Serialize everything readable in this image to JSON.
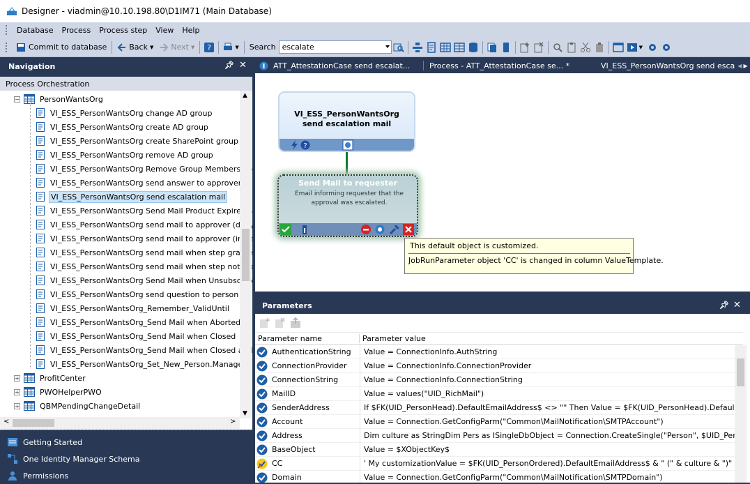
{
  "window": {
    "title": "Designer - viadmin@10.10.198.80\\D1IM71 (Main Database)"
  },
  "menu": [
    "Database",
    "Process",
    "Process step",
    "View",
    "Help"
  ],
  "toolbar": {
    "commit_label": "Commit to database",
    "back_label": "Back",
    "next_label": "Next",
    "search_label": "Search",
    "search_value": "escalate"
  },
  "nav": {
    "header": "Navigation",
    "section": "Process Orchestration",
    "tree": [
      {
        "label": "PersonWantsOrg",
        "kind": "table",
        "expanded": true
      },
      {
        "label": "VI_ESS_PersonWantsOrg change AD group",
        "kind": "process"
      },
      {
        "label": "VI_ESS_PersonWantsOrg create AD group",
        "kind": "process"
      },
      {
        "label": "VI_ESS_PersonWantsOrg create SharePoint group",
        "kind": "process"
      },
      {
        "label": "VI_ESS_PersonWantsOrg remove AD group",
        "kind": "process"
      },
      {
        "label": "VI_ESS_PersonWantsOrg Remove Group Membership",
        "kind": "process"
      },
      {
        "label": "VI_ESS_PersonWantsOrg send answer to approver",
        "kind": "process"
      },
      {
        "label": "VI_ESS_PersonWantsOrg send escalation mail",
        "kind": "process",
        "selected": true
      },
      {
        "label": "VI_ESS_PersonWantsOrg Send Mail Product Expires So",
        "kind": "process"
      },
      {
        "label": "VI_ESS_PersonWantsOrg send mail to approver (deny d",
        "kind": "process"
      },
      {
        "label": "VI_ESS_PersonWantsOrg send mail to approver (insteac",
        "kind": "process"
      },
      {
        "label": "VI_ESS_PersonWantsOrg send mail when step granted",
        "kind": "process"
      },
      {
        "label": "VI_ESS_PersonWantsOrg send mail when step not grar",
        "kind": "process"
      },
      {
        "label": "VI_ESS_PersonWantsOrg Send Mail when Unsubscribe",
        "kind": "process"
      },
      {
        "label": "VI_ESS_PersonWantsOrg send question to person",
        "kind": "process"
      },
      {
        "label": "VI_ESS_PersonWantsOrg_Remember_ValidUntil",
        "kind": "process"
      },
      {
        "label": "VI_ESS_PersonWantsOrg_Send Mail when Aborted",
        "kind": "process"
      },
      {
        "label": "VI_ESS_PersonWantsOrg_Send Mail when Closed",
        "kind": "process"
      },
      {
        "label": "VI_ESS_PersonWantsOrg_Send Mail when Closed and r",
        "kind": "process"
      },
      {
        "label": "VI_ESS_PersonWantsOrg_Set_New_Person.Manager",
        "kind": "process"
      },
      {
        "label": "ProfitCenter",
        "kind": "table",
        "expanded": false
      },
      {
        "label": "PWOHelperPWO",
        "kind": "table",
        "expanded": false
      },
      {
        "label": "QBMPendingChangeDetail",
        "kind": "table",
        "expanded": false
      }
    ],
    "buttons": [
      "Getting Started",
      "One Identity Manager Schema",
      "Permissions"
    ]
  },
  "tabs": [
    {
      "label": "ATT_AttestationCase send escalat..."
    },
    {
      "label": "Process - ATT_AttestationCase se... *"
    },
    {
      "label": "VI_ESS_PersonWantsOrg send esca"
    }
  ],
  "canvas": {
    "process_node": {
      "title": "VI_ESS_PersonWantsOrg send escalation mail"
    },
    "step_node": {
      "title": "Send Mail to requester",
      "description": "Email informing requester that the approval was escalated."
    },
    "tooltip": {
      "line1": "This default object is customized.",
      "line2": "JobRunParameter object 'CC' is changed in column ValueTemplate."
    }
  },
  "params": {
    "header": "Parameters",
    "col_name": "Parameter name",
    "col_value": "Parameter value",
    "rows": [
      {
        "name": "AuthenticationString",
        "value": "Value = ConnectionInfo.AuthString",
        "icon": "check"
      },
      {
        "name": "ConnectionProvider",
        "value": "Value = ConnectionInfo.ConnectionProvider",
        "icon": "check"
      },
      {
        "name": "ConnectionString",
        "value": "Value = ConnectionInfo.ConnectionString",
        "icon": "check"
      },
      {
        "name": "MailID",
        "value": "Value = values(\"UID_RichMail\")",
        "icon": "check"
      },
      {
        "name": "SenderAddress",
        "value": "If $FK(UID_PersonHead).DefaultEmailAddress$ <> \"\" Then Value = $FK(UID_PersonHead).DefaultEmailAdd",
        "icon": "check"
      },
      {
        "name": "Account",
        "value": "Value = Connection.GetConfigParm(\"Common\\MailNotification\\SMTPAccount\")",
        "icon": "check"
      },
      {
        "name": "Address",
        "value": "Dim culture as StringDim Pers as ISingleDbObject = Connection.CreateSingle(\"Person\", $UID_PersonInse",
        "icon": "check"
      },
      {
        "name": "BaseObject",
        "value": "Value = $XObjectKey$",
        "icon": "check"
      },
      {
        "name": "CC",
        "value": "' My customizationValue = $FK(UID_PersonOrdered).DefaultEmailAddress$ & \" (\" & culture & \")\"",
        "icon": "custom"
      },
      {
        "name": "Domain",
        "value": "Value = Connection.GetConfigParm(\"Common\\MailNotification\\SMTPDomain\")",
        "icon": "check"
      }
    ]
  }
}
